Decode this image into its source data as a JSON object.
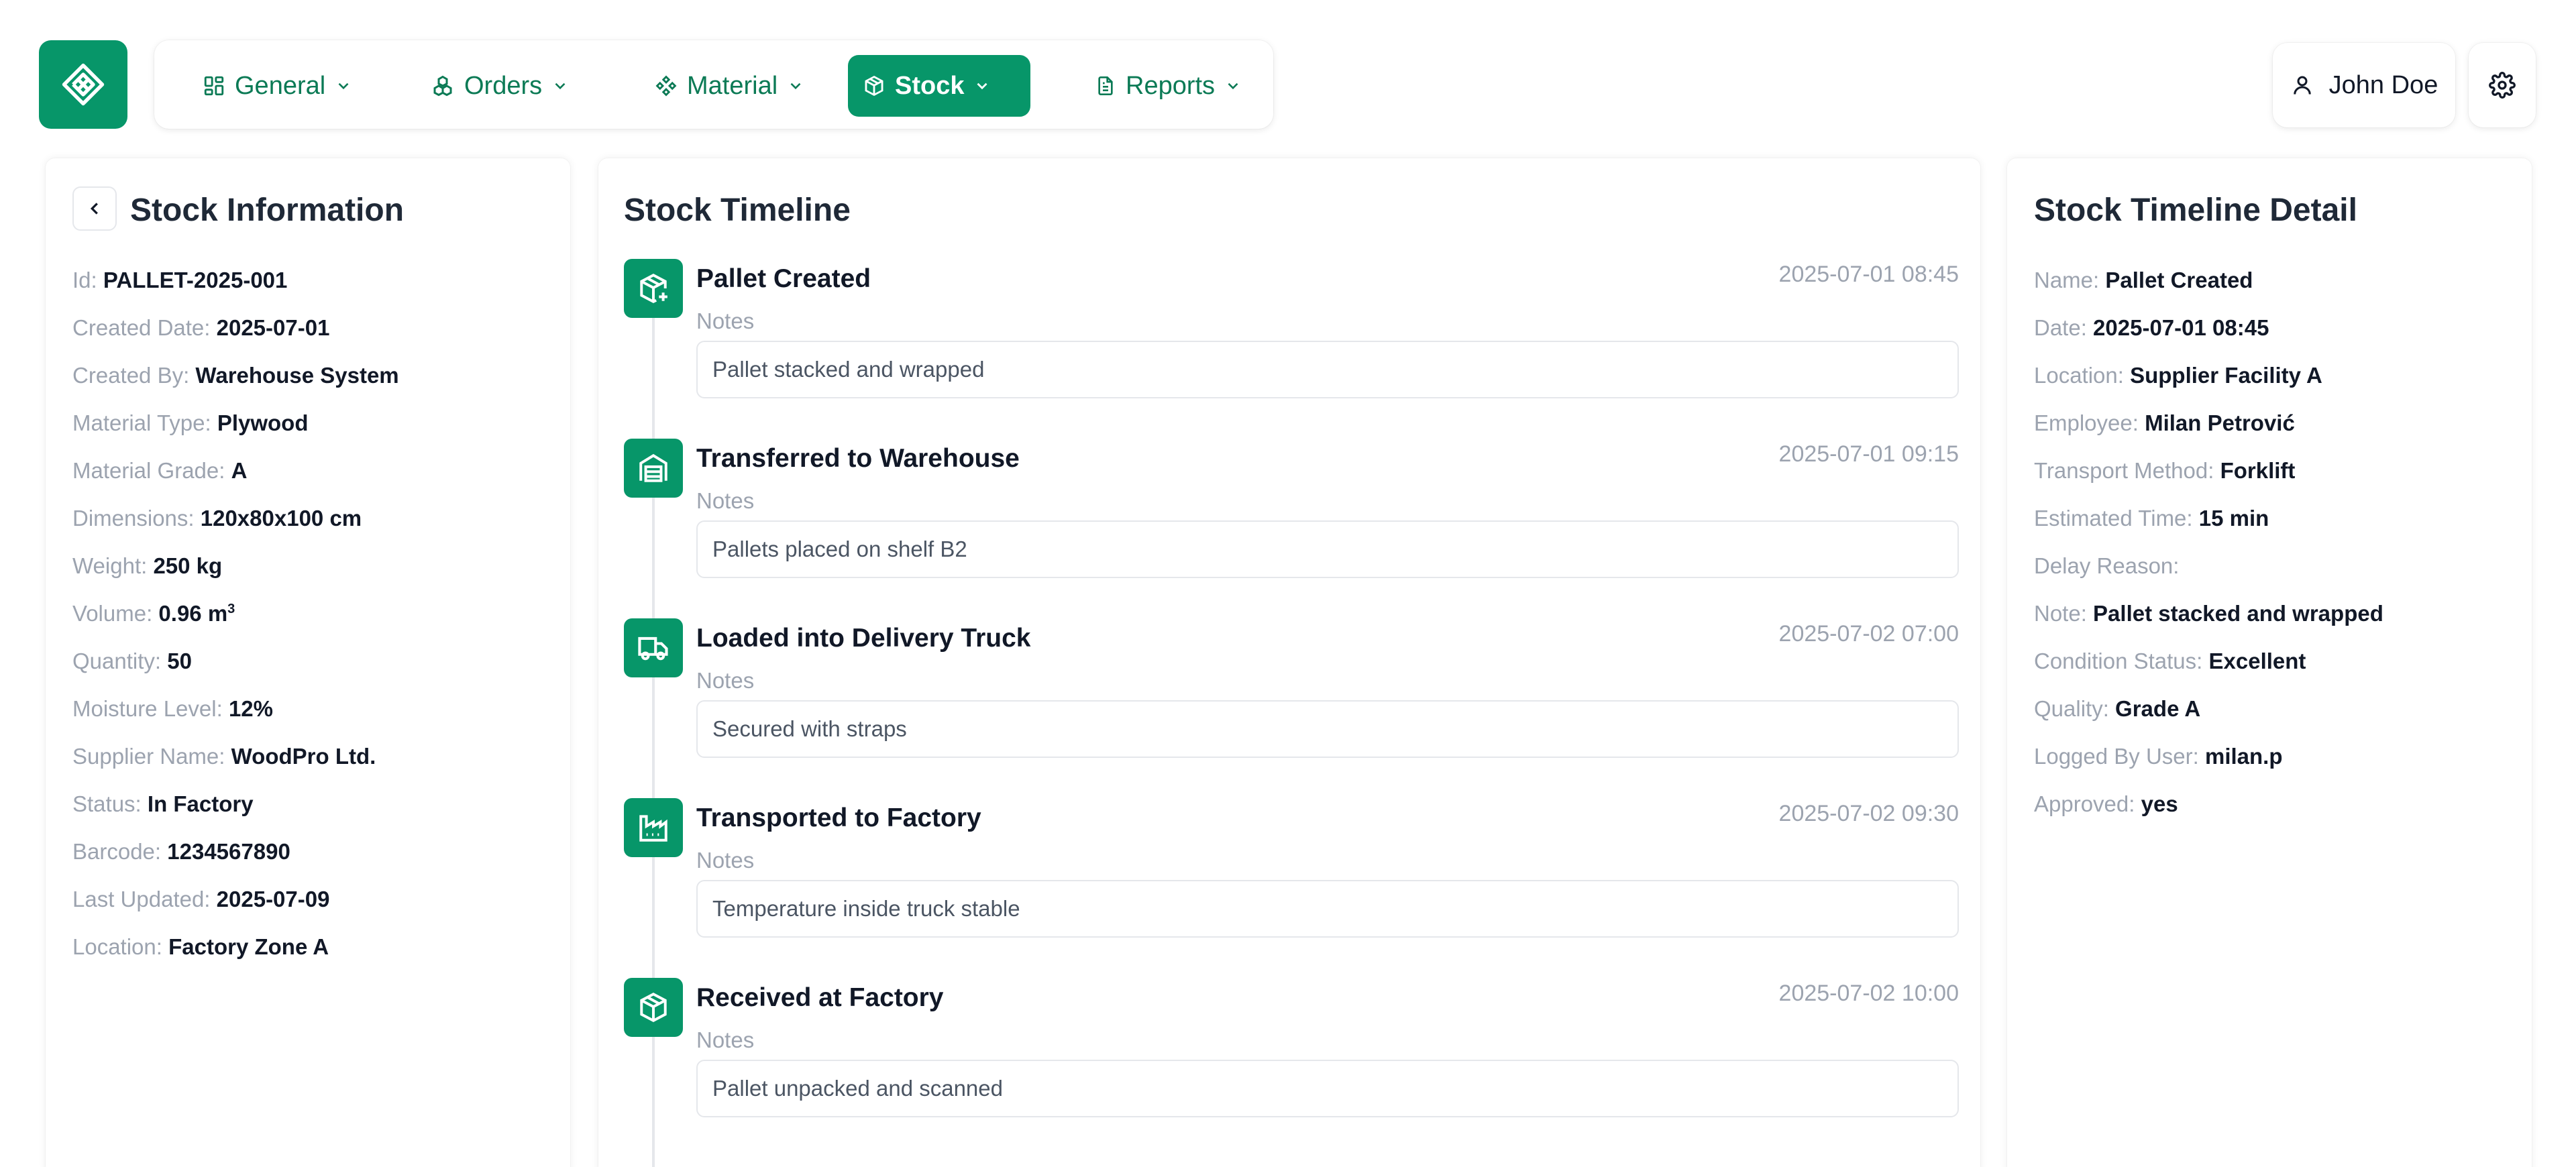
{
  "app": {
    "accent_color": "#079669",
    "logo_icon": "diamond-grid-icon"
  },
  "nav": {
    "items": [
      {
        "label": "General",
        "icon": "grid-icon",
        "active": false
      },
      {
        "label": "Orders",
        "icon": "boxes-icon",
        "active": false
      },
      {
        "label": "Material",
        "icon": "component-icon",
        "active": false
      },
      {
        "label": "Stock",
        "icon": "package-icon",
        "active": true
      },
      {
        "label": "Reports",
        "icon": "document-icon",
        "active": false
      }
    ]
  },
  "user": {
    "name": "John Doe",
    "icon": "user-icon"
  },
  "settings": {
    "icon": "gear-icon"
  },
  "stock_info": {
    "title": "Stock Information",
    "fields": [
      {
        "key": "Id:",
        "value": "PALLET-2025-001"
      },
      {
        "key": "Created Date:",
        "value": "2025-07-01"
      },
      {
        "key": "Created By:",
        "value": "Warehouse System"
      },
      {
        "key": "Material Type:",
        "value": "Plywood"
      },
      {
        "key": "Material Grade:",
        "value": "A"
      },
      {
        "key": "Dimensions:",
        "value": "120x80x100 cm"
      },
      {
        "key": "Weight:",
        "value": "250 kg"
      },
      {
        "key": "Volume:",
        "value": "0.96 m",
        "sup": "3"
      },
      {
        "key": "Quantity:",
        "value": "50"
      },
      {
        "key": "Moisture Level:",
        "value": "12%"
      },
      {
        "key": "Supplier Name:",
        "value": "WoodPro Ltd."
      },
      {
        "key": "Status:",
        "value": "In Factory"
      },
      {
        "key": "Barcode:",
        "value": "1234567890"
      },
      {
        "key": "Last Updated:",
        "value": "2025-07-09"
      },
      {
        "key": "Location:",
        "value": "Factory Zone A"
      }
    ]
  },
  "timeline": {
    "title": "Stock Timeline",
    "notes_label": "Notes",
    "entries": [
      {
        "name": "Pallet Created",
        "date": "2025-07-01 08:45",
        "notes": "Pallet stacked and wrapped",
        "icon": "package-plus-icon"
      },
      {
        "name": "Transferred to Warehouse",
        "date": "2025-07-01 09:15",
        "notes": "Pallets placed on shelf B2",
        "icon": "warehouse-icon"
      },
      {
        "name": "Loaded into Delivery Truck",
        "date": "2025-07-02 07:00",
        "notes": "Secured with straps",
        "icon": "truck-icon"
      },
      {
        "name": "Transported to Factory",
        "date": "2025-07-02 09:30",
        "notes": "Temperature inside truck stable",
        "icon": "factory-icon"
      },
      {
        "name": "Received at Factory",
        "date": "2025-07-02 10:00",
        "notes": "Pallet unpacked and scanned",
        "icon": "package-check-icon"
      }
    ]
  },
  "detail": {
    "title": "Stock Timeline Detail",
    "fields": [
      {
        "key": "Name:",
        "value": "Pallet Created"
      },
      {
        "key": "Date:",
        "value": "2025-07-01 08:45"
      },
      {
        "key": "Location:",
        "value": "Supplier Facility A"
      },
      {
        "key": "Employee:",
        "value": "Milan Petrović"
      },
      {
        "key": "Transport Method:",
        "value": "Forklift"
      },
      {
        "key": "Estimated Time:",
        "value": "15 min"
      },
      {
        "key": "Delay Reason:",
        "value": ""
      },
      {
        "key": "Note:",
        "value": "Pallet stacked and wrapped"
      },
      {
        "key": "Condition Status:",
        "value": "Excellent"
      },
      {
        "key": "Quality:",
        "value": "Grade A"
      },
      {
        "key": "Logged By User:",
        "value": "milan.p"
      },
      {
        "key": "Approved:",
        "value": "yes"
      }
    ]
  }
}
